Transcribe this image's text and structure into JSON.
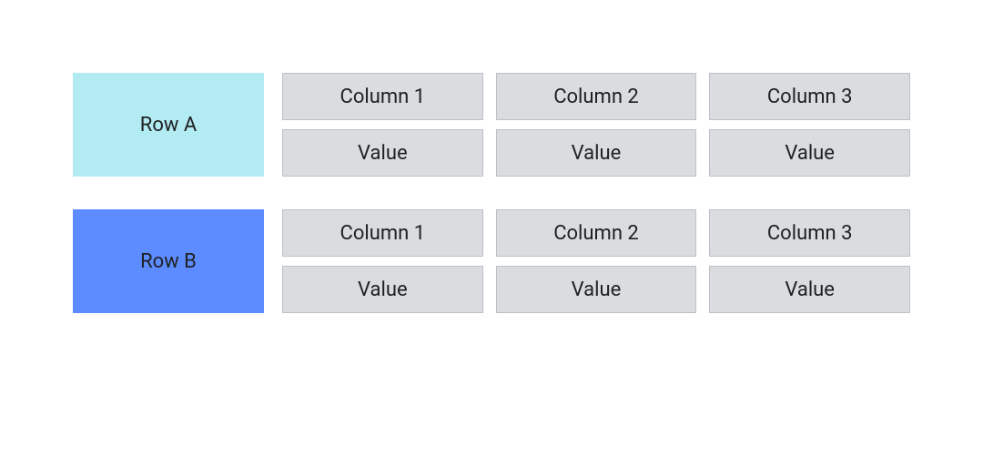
{
  "rows": [
    {
      "id": "a",
      "label": "Row A",
      "color_class": "a",
      "cells": {
        "headers": [
          "Column 1",
          "Column 2",
          "Column 3"
        ],
        "values": [
          "Value",
          "Value",
          "Value"
        ]
      }
    },
    {
      "id": "b",
      "label": "Row B",
      "color_class": "b",
      "cells": {
        "headers": [
          "Column 1",
          "Column 2",
          "Column 3"
        ],
        "values": [
          "Value",
          "Value",
          "Value"
        ]
      }
    }
  ]
}
